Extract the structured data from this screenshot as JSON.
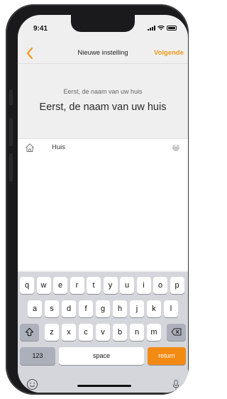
{
  "status_bar": {
    "time": "9:41"
  },
  "nav": {
    "title": "Nieuwe instelling",
    "next_label": "Volgende"
  },
  "content": {
    "subtitle": "Eerst, de naam van uw huis",
    "title": "Eerst, de naam van uw huis"
  },
  "name_input": {
    "value": "Huis"
  },
  "keyboard": {
    "row1": [
      "q",
      "w",
      "e",
      "r",
      "t",
      "y",
      "u",
      "i",
      "o",
      "p"
    ],
    "row2": [
      "a",
      "s",
      "d",
      "f",
      "g",
      "h",
      "j",
      "k",
      "l"
    ],
    "row3": [
      "z",
      "x",
      "c",
      "v",
      "b",
      "n",
      "m"
    ],
    "numbers_label": "123",
    "space_label": "space",
    "return_label": "return"
  },
  "colors": {
    "accent": "#f39a1b",
    "return_key": "#f28a13"
  }
}
